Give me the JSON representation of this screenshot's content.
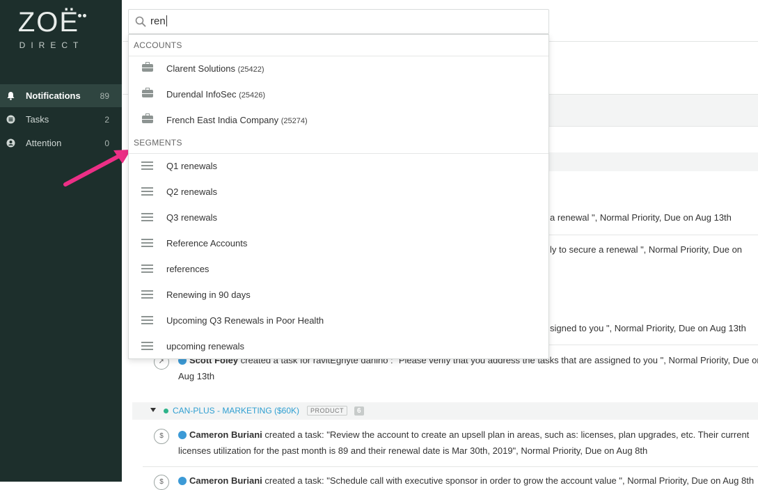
{
  "sidebar": {
    "logo_main": "ZOË",
    "logo_sub": "DIRECT",
    "items": [
      {
        "label": "Notifications",
        "count": "89",
        "icon": "bell-icon"
      },
      {
        "label": "Tasks",
        "count": "2",
        "icon": "tasks-icon"
      },
      {
        "label": "Attention",
        "count": "0",
        "icon": "attention-icon"
      }
    ]
  },
  "search": {
    "value": "ren",
    "icon": "search-icon"
  },
  "dropdown": {
    "accounts_header": "ACCOUNTS",
    "accounts": [
      {
        "name": "Clarent Solutions",
        "id": "(25422)"
      },
      {
        "name": "Durendal InfoSec",
        "id": "(25426)"
      },
      {
        "name": "French East India Company",
        "id": "(25274)"
      }
    ],
    "segments_header": "SEGMENTS",
    "segments": [
      {
        "name": "Q1 renewals"
      },
      {
        "name": "Q2 renewals"
      },
      {
        "name": "Q3 renewals"
      },
      {
        "name": "Reference Accounts"
      },
      {
        "name": "references"
      },
      {
        "name": "Renewing in 90 days"
      },
      {
        "name": "Upcoming Q3 Renewals in Poor Health"
      },
      {
        "name": "upcoming renewals"
      }
    ]
  },
  "background": {
    "row1_tail": "a renewal \", Normal Priority, Due on Aug 13th",
    "row2_tail": "ly to secure a renewal \", Normal Priority, Due on",
    "row3_tail": "signed to you \", Normal Priority, Due on Aug 13th",
    "row4_author": "Scott Foley",
    "row4_text": " created a task for ravitEgnyte danino : \"Please verify that you address the tasks that are assigned to you \", Normal Priority, Due on",
    "row4_line2": "Aug 13th",
    "group_name": "CAN-PLUS - MARKETING ($60K)",
    "group_tag": "PRODUCT",
    "group_count": "6",
    "row5_author": "Cameron Buriani",
    "row5_text": " created a task: \"Review the account to create an upsell plan in areas, such as: licenses, plan upgrades, etc. Their current",
    "row5_line2": "licenses utilization for the past month is 89 and their renewal date is Mar 30th, 2019\", Normal Priority, Due on Aug 8th",
    "row6_author": "Cameron Buriani",
    "row6_text": " created a task: \"Schedule call with executive sponsor in order to grow the account value \", Normal Priority, Due on Aug 8th"
  },
  "colors": {
    "sidebar_bg": "#1d2f2c",
    "active_bg": "#2f4540",
    "accent_blue": "#2f9fd1",
    "arrow": "#ec2f86"
  }
}
